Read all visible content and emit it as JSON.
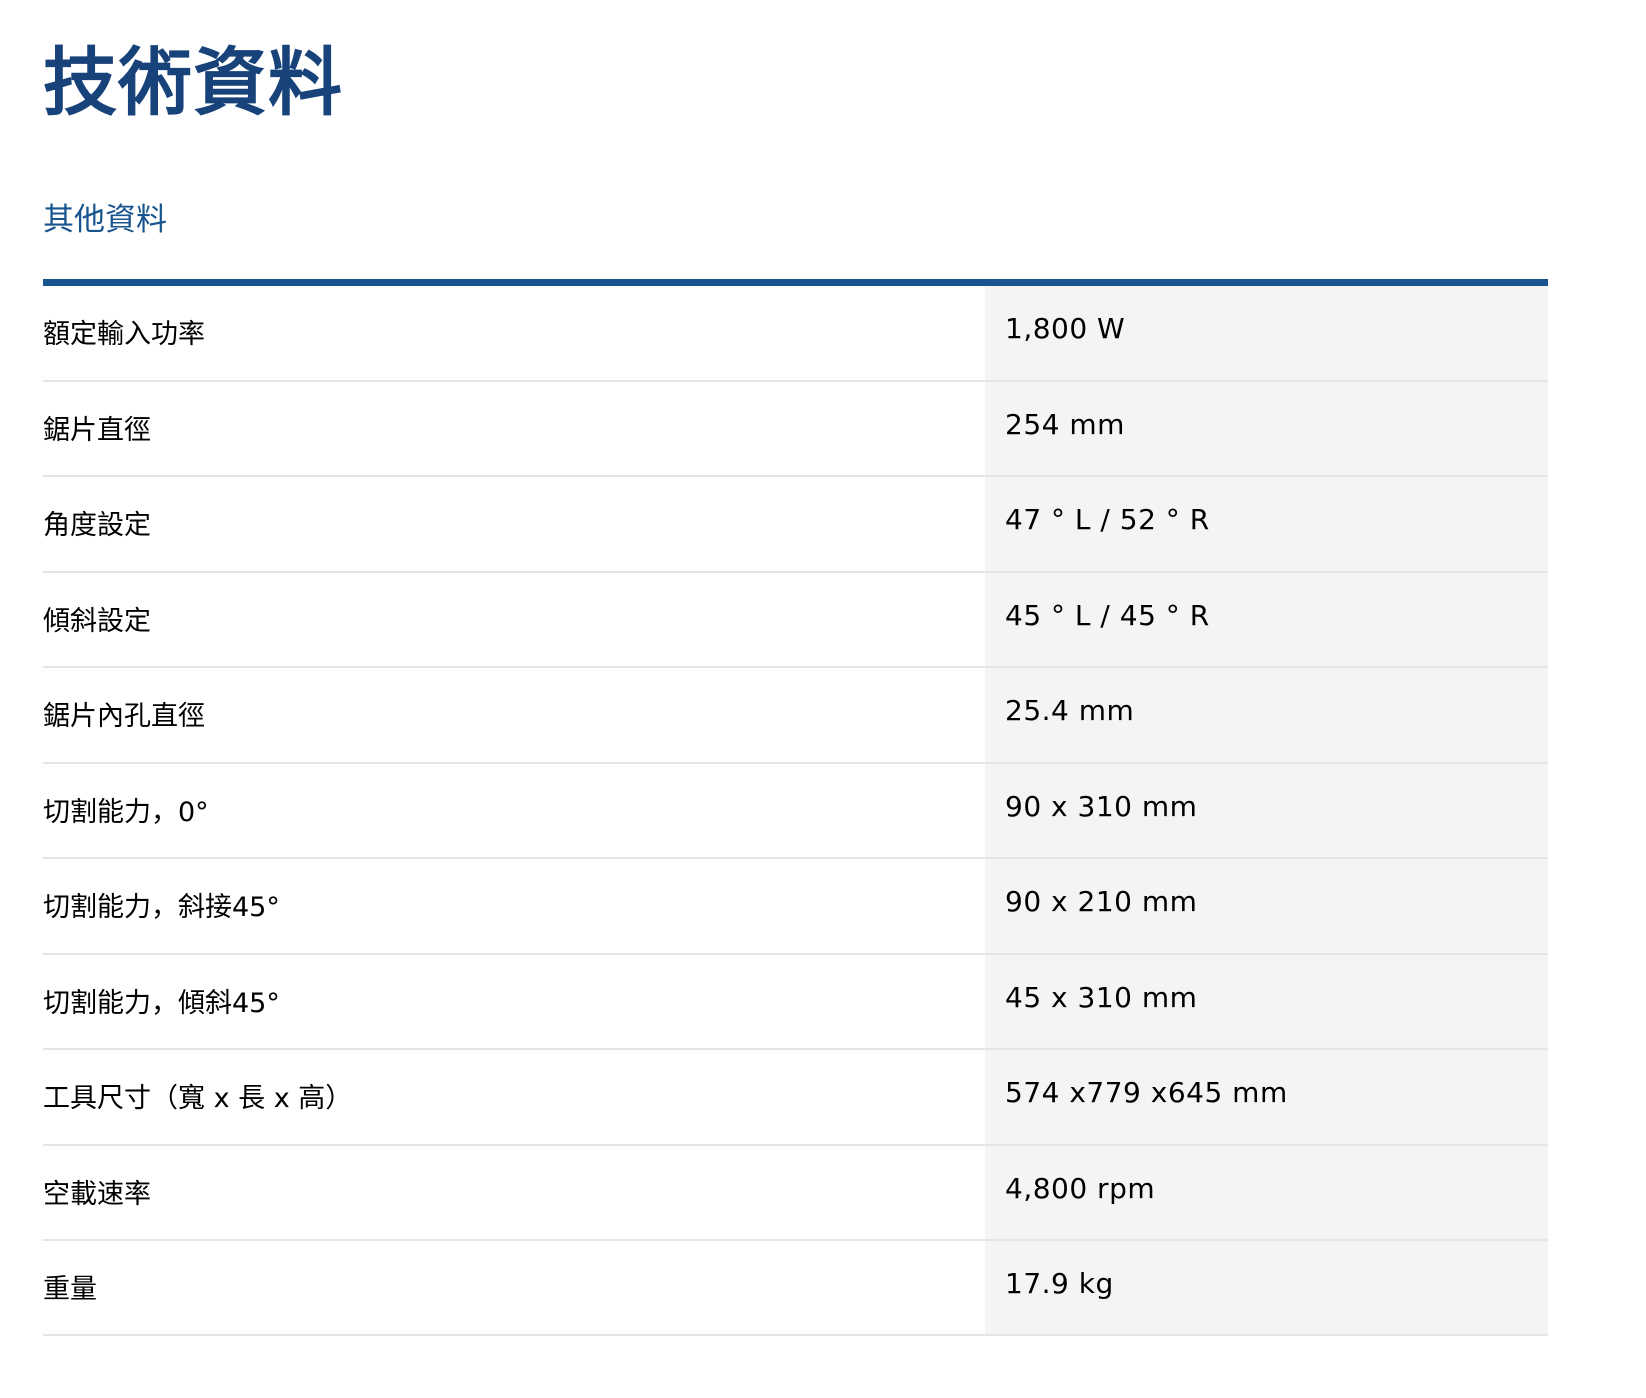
{
  "page": {
    "title": "技術資料",
    "subtitle": "其他資料"
  },
  "colors": {
    "title": "#18427a",
    "accent": "#18558f",
    "value_background": "#f3f5f5",
    "divider": "#e3e5e6"
  },
  "specs": [
    {
      "label": "額定輸入功率",
      "value": "1,800 W"
    },
    {
      "label": "鋸片直徑",
      "value": "254 mm"
    },
    {
      "label": "角度設定",
      "value": "47 ° L / 52 ° R"
    },
    {
      "label": "傾斜設定",
      "value": "45 ° L / 45 ° R"
    },
    {
      "label": "鋸片內孔直徑",
      "value": "25.4 mm"
    },
    {
      "label": "切割能力，0°",
      "value": "90 x 310 mm"
    },
    {
      "label": "切割能力，斜接45°",
      "value": "90 x 210 mm"
    },
    {
      "label": "切割能力，傾斜45°",
      "value": "45 x 310 mm"
    },
    {
      "label": "工具尺寸（寬 x 長 x 高）",
      "value": "574 x779 x645 mm"
    },
    {
      "label": "空載速率",
      "value": "4,800 rpm"
    },
    {
      "label": "重量",
      "value": "17.9 kg"
    }
  ]
}
